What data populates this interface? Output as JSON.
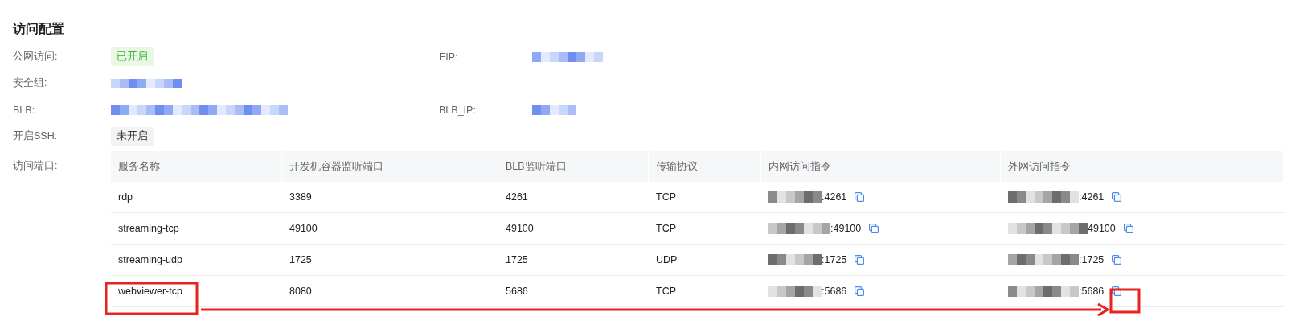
{
  "section_title": "访问配置",
  "fields": [
    {
      "label": "公网访问:",
      "kind": "tag",
      "value": "已开启",
      "on": true,
      "right": {
        "label": "EIP:",
        "kind": "redacted"
      }
    },
    {
      "label": "安全组:",
      "kind": "redacted"
    },
    {
      "label": "BLB:",
      "kind": "redacted"
    },
    {
      "label": "开启SSH:",
      "kind": "tag",
      "value": "未开启",
      "on": false
    }
  ],
  "blb_ip_label": "BLB_IP:",
  "ports_label": "访问端口:",
  "table": {
    "columns": [
      "服务名称",
      "开发机容器监听端口",
      "BLB监听端口",
      "传输协议",
      "内网访问指令",
      "外网访问指令"
    ],
    "rows": [
      {
        "name": "rdp",
        "container_port": "3389",
        "blb_port": "4261",
        "protocol": "TCP",
        "internal": ":4261",
        "external": ":4261"
      },
      {
        "name": "streaming-tcp",
        "container_port": "49100",
        "blb_port": "49100",
        "protocol": "TCP",
        "internal": ":49100",
        "external": "49100"
      },
      {
        "name": "streaming-udp",
        "container_port": "1725",
        "blb_port": "1725",
        "protocol": "UDP",
        "internal": ":1725",
        "external": ":1725"
      },
      {
        "name": "webviewer-tcp",
        "container_port": "8080",
        "blb_port": "5686",
        "protocol": "TCP",
        "internal": ":5686",
        "external": ":5686"
      }
    ]
  }
}
